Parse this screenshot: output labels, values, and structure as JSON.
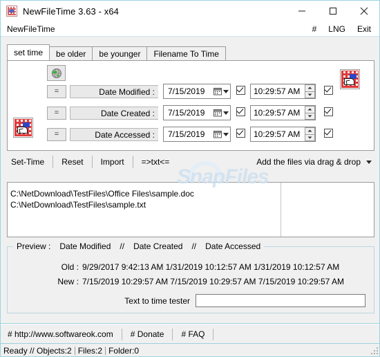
{
  "window": {
    "title": "NewFileTime 3.63 - x64",
    "app_icon": "calendar-clock-icon",
    "minimize_label": "Minimize",
    "maximize_label": "Maximize",
    "close_label": "Close",
    "border_color": "#9bd3e0"
  },
  "menubar": {
    "left_item": "NewFileTime",
    "right_items": [
      "#",
      "LNG",
      "Exit"
    ]
  },
  "tabs": [
    {
      "label": "set time",
      "active": true
    },
    {
      "label": "be older",
      "active": false
    },
    {
      "label": "be younger",
      "active": false
    },
    {
      "label": "Filename To Time",
      "active": false
    }
  ],
  "settime_panel": {
    "globe_button": "globe-icon",
    "clock_icon_right": "red-grid-cursor-icon",
    "clock_icon_left": "red-grid-cursor-icon",
    "rows": [
      {
        "operator": "=",
        "label": "Date Modified :",
        "date": "7/15/2019",
        "date_checked": true,
        "time": "10:29:57 AM",
        "time_checked": true
      },
      {
        "operator": "=",
        "label": "Date Created :",
        "date": "7/15/2019",
        "date_checked": true,
        "time": "10:29:57 AM",
        "time_checked": true
      },
      {
        "operator": "=",
        "label": "Date Accessed :",
        "date": "7/15/2019",
        "date_checked": true,
        "time": "10:29:57 AM",
        "time_checked": true
      }
    ]
  },
  "actionbar": {
    "buttons": [
      "Set-Time",
      "Reset",
      "Import",
      "=>txt<="
    ],
    "dragdrop_label": "Add the files via drag & drop"
  },
  "filelist": {
    "items": [
      "C:\\NetDownload\\TestFiles\\Office Files\\sample.doc",
      "C:\\NetDownload\\TestFiles\\sample.txt"
    ]
  },
  "watermark": {
    "text": "SnapFiles"
  },
  "preview": {
    "legend": [
      "Preview :",
      "Date Modified",
      "//",
      "Date Created",
      "//",
      "Date Accessed"
    ],
    "old_label": "Old :",
    "old_values": "9/29/2017 9:42:13 AM   1/31/2019 10:12:57 AM 1/31/2019 10:12:57 AM",
    "new_label": "New :",
    "new_values": "7/15/2019 10:29:57 AM 7/15/2019 10:29:57 AM 7/15/2019 10:29:57 AM",
    "tester_label": "Text to time tester",
    "tester_value": "",
    "tester_placeholder": ""
  },
  "links": [
    "# http://www.softwareok.com",
    "# Donate",
    "# FAQ"
  ],
  "statusbar": {
    "ready": "Ready // Objects:2",
    "files": "Files:2",
    "folder": "Folder:0"
  }
}
